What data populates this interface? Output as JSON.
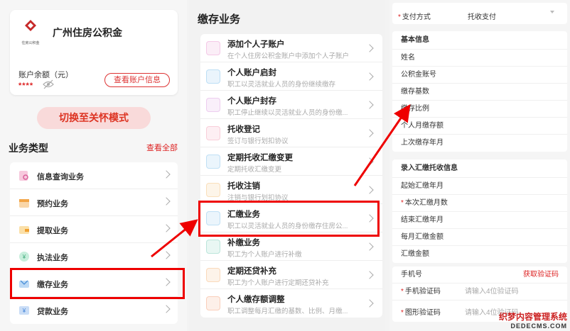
{
  "left": {
    "brand": "广州住房公积金",
    "logo_text": "住房公积金",
    "balance_label": "账户余额（元）",
    "balance_masked": "****",
    "view_account_btn": "查看账户信息",
    "care_mode_btn": "切换至关怀模式",
    "section_title": "业务类型",
    "see_all": "查看全部",
    "items": [
      {
        "label": "信息查询业务",
        "icon": "info-query-icon"
      },
      {
        "label": "预约业务",
        "icon": "calendar-icon"
      },
      {
        "label": "提取业务",
        "icon": "wallet-icon"
      },
      {
        "label": "执法业务",
        "icon": "law-icon"
      },
      {
        "label": "缴存业务",
        "icon": "deposit-icon"
      },
      {
        "label": "贷款业务",
        "icon": "loan-icon"
      }
    ]
  },
  "mid": {
    "title": "缴存业务",
    "items": [
      {
        "title": "添加个人子账户",
        "sub": "在个人住房公积金账户中添加个人子账户",
        "icon": "add-sub-account-icon",
        "color": "#e37fc6"
      },
      {
        "title": "个人账户启封",
        "sub": "职工以灵活就业人员的身份继续缴存",
        "icon": "unseal-icon",
        "color": "#5fb0e8"
      },
      {
        "title": "个人账户封存",
        "sub": "职工停止继续以灵活就业人员的身份缴...",
        "icon": "seal-icon",
        "color": "#d586d8"
      },
      {
        "title": "托收登记",
        "sub": "签订与银行划扣协议",
        "icon": "register-icon",
        "color": "#f08aa6"
      },
      {
        "title": "定期托收汇缴变更",
        "sub": "定期托收汇缴变更",
        "icon": "change-icon",
        "color": "#69b4e6"
      },
      {
        "title": "托收注销",
        "sub": "注销与银行划扣协议",
        "icon": "cancel-icon",
        "color": "#f2b25c"
      },
      {
        "title": "汇缴业务",
        "sub": "职工以灵活就业人员的身份缴存住房公...",
        "icon": "remit-icon",
        "color": "#67b3e8"
      },
      {
        "title": "补缴业务",
        "sub": "职工为个人账户进行补缴",
        "icon": "supplement-icon",
        "color": "#5cc0a8"
      },
      {
        "title": "定期还贷补充",
        "sub": "职工为个人账户进行定期还贷补充",
        "icon": "repay-icon",
        "color": "#f2a45c"
      },
      {
        "title": "个人缴存额调整",
        "sub": "职工调整每月汇缴的基数、比例、月缴...",
        "icon": "adjust-icon",
        "color": "#f28c5c"
      }
    ]
  },
  "right": {
    "payment_label": "支付方式",
    "payment_value": "托收支付",
    "basic_head": "基本信息",
    "basic_items": [
      "姓名",
      "公积金账号",
      "缴存基数",
      "缴存比例",
      "个人月缴存额",
      "上次缴存年月"
    ],
    "entry_head": "录入汇缴托收信息",
    "entry_items": [
      {
        "label": "起始汇缴年月",
        "req": false
      },
      {
        "label": "本次汇缴月数",
        "req": true
      },
      {
        "label": "结束汇缴年月",
        "req": false
      },
      {
        "label": "每月汇缴金额",
        "req": false
      },
      {
        "label": "汇缴金额",
        "req": false
      }
    ],
    "phone_label": "手机号",
    "get_code": "获取验证码",
    "sms_label": "手机验证码",
    "sms_placeholder": "请输入4位验证码",
    "img_label": "图形验证码",
    "img_placeholder": "请输入4位验证码"
  },
  "watermark": {
    "line1": "织梦内容管理系统",
    "line2": "DEDECMS.COM"
  },
  "colors": {
    "accent": "#d32222",
    "highlight": "#e00000"
  }
}
